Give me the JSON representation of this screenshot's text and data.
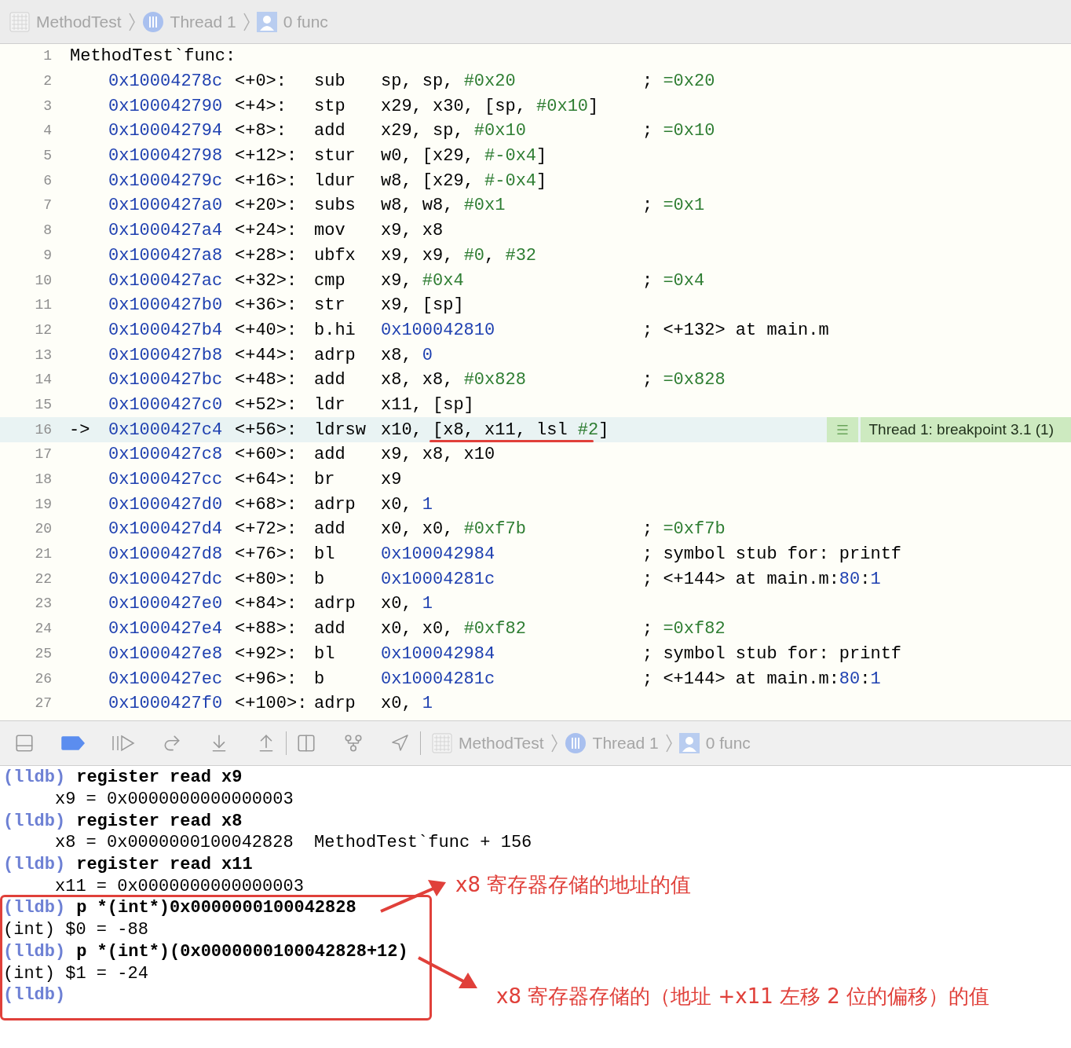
{
  "breadcrumb": [
    {
      "kind": "project",
      "label": "MethodTest"
    },
    {
      "kind": "thread",
      "label": "Thread 1"
    },
    {
      "kind": "frame",
      "label": "0 func"
    }
  ],
  "disassembly": {
    "rows": [
      {
        "kind": "label",
        "line": "1",
        "text": "MethodTest`func:",
        "current": false
      },
      {
        "kind": "instr",
        "line": "2",
        "address": "0x10004278c",
        "offset": "<+0>:",
        "mnemonic": "sub",
        "operands": "sp, sp, #0x20",
        "comment": "; =0x20",
        "current": false
      },
      {
        "kind": "instr",
        "line": "3",
        "address": "0x100042790",
        "offset": "<+4>:",
        "mnemonic": "stp",
        "operands": "x29, x30, [sp, #0x10]",
        "current": false
      },
      {
        "kind": "instr",
        "line": "4",
        "address": "0x100042794",
        "offset": "<+8>:",
        "mnemonic": "add",
        "operands": "x29, sp, #0x10",
        "comment": "; =0x10",
        "current": false
      },
      {
        "kind": "instr",
        "line": "5",
        "address": "0x100042798",
        "offset": "<+12>:",
        "mnemonic": "stur",
        "operands": "w0, [x29, #-0x4]",
        "current": false
      },
      {
        "kind": "instr",
        "line": "6",
        "address": "0x10004279c",
        "offset": "<+16>:",
        "mnemonic": "ldur",
        "operands": "w8, [x29, #-0x4]",
        "current": false
      },
      {
        "kind": "instr",
        "line": "7",
        "address": "0x1000427a0",
        "offset": "<+20>:",
        "mnemonic": "subs",
        "operands": "w8, w8, #0x1",
        "comment": "; =0x1",
        "current": false
      },
      {
        "kind": "instr",
        "line": "8",
        "address": "0x1000427a4",
        "offset": "<+24>:",
        "mnemonic": "mov",
        "operands": "x9, x8",
        "current": false
      },
      {
        "kind": "instr",
        "line": "9",
        "address": "0x1000427a8",
        "offset": "<+28>:",
        "mnemonic": "ubfx",
        "operands": "x9, x9, #0, #32",
        "current": false
      },
      {
        "kind": "instr",
        "line": "10",
        "address": "0x1000427ac",
        "offset": "<+32>:",
        "mnemonic": "cmp",
        "operands": "x9, #0x4",
        "comment": "; =0x4",
        "current": false
      },
      {
        "kind": "instr",
        "line": "11",
        "address": "0x1000427b0",
        "offset": "<+36>:",
        "mnemonic": "str",
        "operands": "x9, [sp]",
        "current": false
      },
      {
        "kind": "instr",
        "line": "12",
        "address": "0x1000427b4",
        "offset": "<+40>:",
        "mnemonic": "b.hi",
        "operands": "0x100042810",
        "comment": "; <+132> at main.m",
        "current": false
      },
      {
        "kind": "instr",
        "line": "13",
        "address": "0x1000427b8",
        "offset": "<+44>:",
        "mnemonic": "adrp",
        "operands": "x8, 0",
        "current": false
      },
      {
        "kind": "instr",
        "line": "14",
        "address": "0x1000427bc",
        "offset": "<+48>:",
        "mnemonic": "add",
        "operands": "x8, x8, #0x828",
        "comment": "; =0x828",
        "current": false
      },
      {
        "kind": "instr",
        "line": "15",
        "address": "0x1000427c0",
        "offset": "<+52>:",
        "mnemonic": "ldr",
        "operands": "x11, [sp]",
        "current": false
      },
      {
        "kind": "instr",
        "line": "16",
        "arrow": "->",
        "address": "0x1000427c4",
        "offset": "<+56>:",
        "mnemonic": "ldrsw",
        "operands": "x10, [x8, x11, lsl #2]",
        "badge": "Thread 1: breakpoint 3.1 (1)",
        "current": true
      },
      {
        "kind": "instr",
        "line": "17",
        "address": "0x1000427c8",
        "offset": "<+60>:",
        "mnemonic": "add",
        "operands": "x9, x8, x10",
        "current": false
      },
      {
        "kind": "instr",
        "line": "18",
        "address": "0x1000427cc",
        "offset": "<+64>:",
        "mnemonic": "br",
        "operands": "x9",
        "current": false
      },
      {
        "kind": "instr",
        "line": "19",
        "address": "0x1000427d0",
        "offset": "<+68>:",
        "mnemonic": "adrp",
        "operands": "x0, 1",
        "current": false
      },
      {
        "kind": "instr",
        "line": "20",
        "address": "0x1000427d4",
        "offset": "<+72>:",
        "mnemonic": "add",
        "operands": "x0, x0, #0xf7b",
        "comment": "; =0xf7b",
        "current": false
      },
      {
        "kind": "instr",
        "line": "21",
        "address": "0x1000427d8",
        "offset": "<+76>:",
        "mnemonic": "bl",
        "operands": "0x100042984",
        "comment": "; symbol stub for: printf",
        "current": false
      },
      {
        "kind": "instr",
        "line": "22",
        "address": "0x1000427dc",
        "offset": "<+80>:",
        "mnemonic": "b",
        "operands": "0x10004281c",
        "comment": "; <+144> at main.m:80:1",
        "current": false
      },
      {
        "kind": "instr",
        "line": "23",
        "address": "0x1000427e0",
        "offset": "<+84>:",
        "mnemonic": "adrp",
        "operands": "x0, 1",
        "current": false
      },
      {
        "kind": "instr",
        "line": "24",
        "address": "0x1000427e4",
        "offset": "<+88>:",
        "mnemonic": "add",
        "operands": "x0, x0, #0xf82",
        "comment": "; =0xf82",
        "current": false
      },
      {
        "kind": "instr",
        "line": "25",
        "address": "0x1000427e8",
        "offset": "<+92>:",
        "mnemonic": "bl",
        "operands": "0x100042984",
        "comment": "; symbol stub for: printf",
        "current": false
      },
      {
        "kind": "instr",
        "line": "26",
        "address": "0x1000427ec",
        "offset": "<+96>:",
        "mnemonic": "b",
        "operands": "0x10004281c",
        "comment": "; <+144> at main.m:80:1",
        "current": false
      },
      {
        "kind": "instr",
        "line": "27",
        "address": "0x1000427f0",
        "offset": "<+100>:",
        "mnemonic": "adrp",
        "operands": "x0, 1",
        "current": false
      }
    ]
  },
  "debug_toolbar": {
    "breakpoints_active": true,
    "breadcrumb": [
      {
        "kind": "project",
        "label": "MethodTest"
      },
      {
        "kind": "thread",
        "label": "Thread 1"
      },
      {
        "kind": "frame",
        "label": "0 func"
      }
    ]
  },
  "console": {
    "lines": [
      {
        "kind": "prompt",
        "prompt": "(lldb)",
        "command": "register read x9"
      },
      {
        "kind": "output",
        "text": "x9 = 0x0000000000000003"
      },
      {
        "kind": "prompt",
        "prompt": "(lldb)",
        "command": "register read x8"
      },
      {
        "kind": "output",
        "text": "x8 = 0x0000000100042828  MethodTest`func + 156"
      },
      {
        "kind": "prompt",
        "prompt": "(lldb)",
        "command": "register read x11"
      },
      {
        "kind": "output",
        "text": "x11 = 0x0000000000000003"
      },
      {
        "kind": "prompt",
        "prompt": "(lldb)",
        "command": "p *(int*)0x0000000100042828"
      },
      {
        "kind": "result",
        "text": "(int) $0 = -88"
      },
      {
        "kind": "prompt",
        "prompt": "(lldb)",
        "command": "p *(int*)(0x0000000100042828+12)"
      },
      {
        "kind": "result",
        "text": "(int) $1 = -24"
      },
      {
        "kind": "prompt",
        "prompt": "(lldb)"
      }
    ]
  },
  "annotations": [
    {
      "text": "x8 寄存器存储的地址的值"
    },
    {
      "text": "x8 寄存器存储的（地址 +x11 左移 2 位的偏移）的值"
    }
  ]
}
